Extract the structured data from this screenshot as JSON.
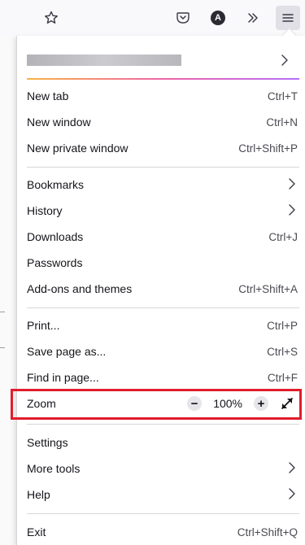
{
  "toolbar": {
    "icons": [
      "star-icon",
      "pocket-icon",
      "account-icon",
      "overflow-icon",
      "menu-icon"
    ],
    "account_initial": "A"
  },
  "menu": {
    "account_chevron": "›",
    "new_tab": {
      "label": "New tab",
      "shortcut": "Ctrl+T"
    },
    "new_window": {
      "label": "New window",
      "shortcut": "Ctrl+N"
    },
    "new_private_window": {
      "label": "New private window",
      "shortcut": "Ctrl+Shift+P"
    },
    "bookmarks": {
      "label": "Bookmarks"
    },
    "history": {
      "label": "History"
    },
    "downloads": {
      "label": "Downloads",
      "shortcut": "Ctrl+J"
    },
    "passwords": {
      "label": "Passwords"
    },
    "addons": {
      "label": "Add-ons and themes",
      "shortcut": "Ctrl+Shift+A"
    },
    "print": {
      "label": "Print...",
      "shortcut": "Ctrl+P"
    },
    "save_page": {
      "label": "Save page as...",
      "shortcut": "Ctrl+S"
    },
    "find": {
      "label": "Find in page...",
      "shortcut": "Ctrl+F"
    },
    "zoom": {
      "label": "Zoom",
      "minus": "−",
      "value": "100%",
      "plus": "+"
    },
    "settings": {
      "label": "Settings"
    },
    "more_tools": {
      "label": "More tools"
    },
    "help": {
      "label": "Help"
    },
    "exit": {
      "label": "Exit",
      "shortcut": "Ctrl+Shift+Q"
    }
  },
  "colors": {
    "highlight": "#e11d2b",
    "accent_gradient": [
      "#f5a623",
      "#ec4899",
      "#a855f7"
    ]
  }
}
